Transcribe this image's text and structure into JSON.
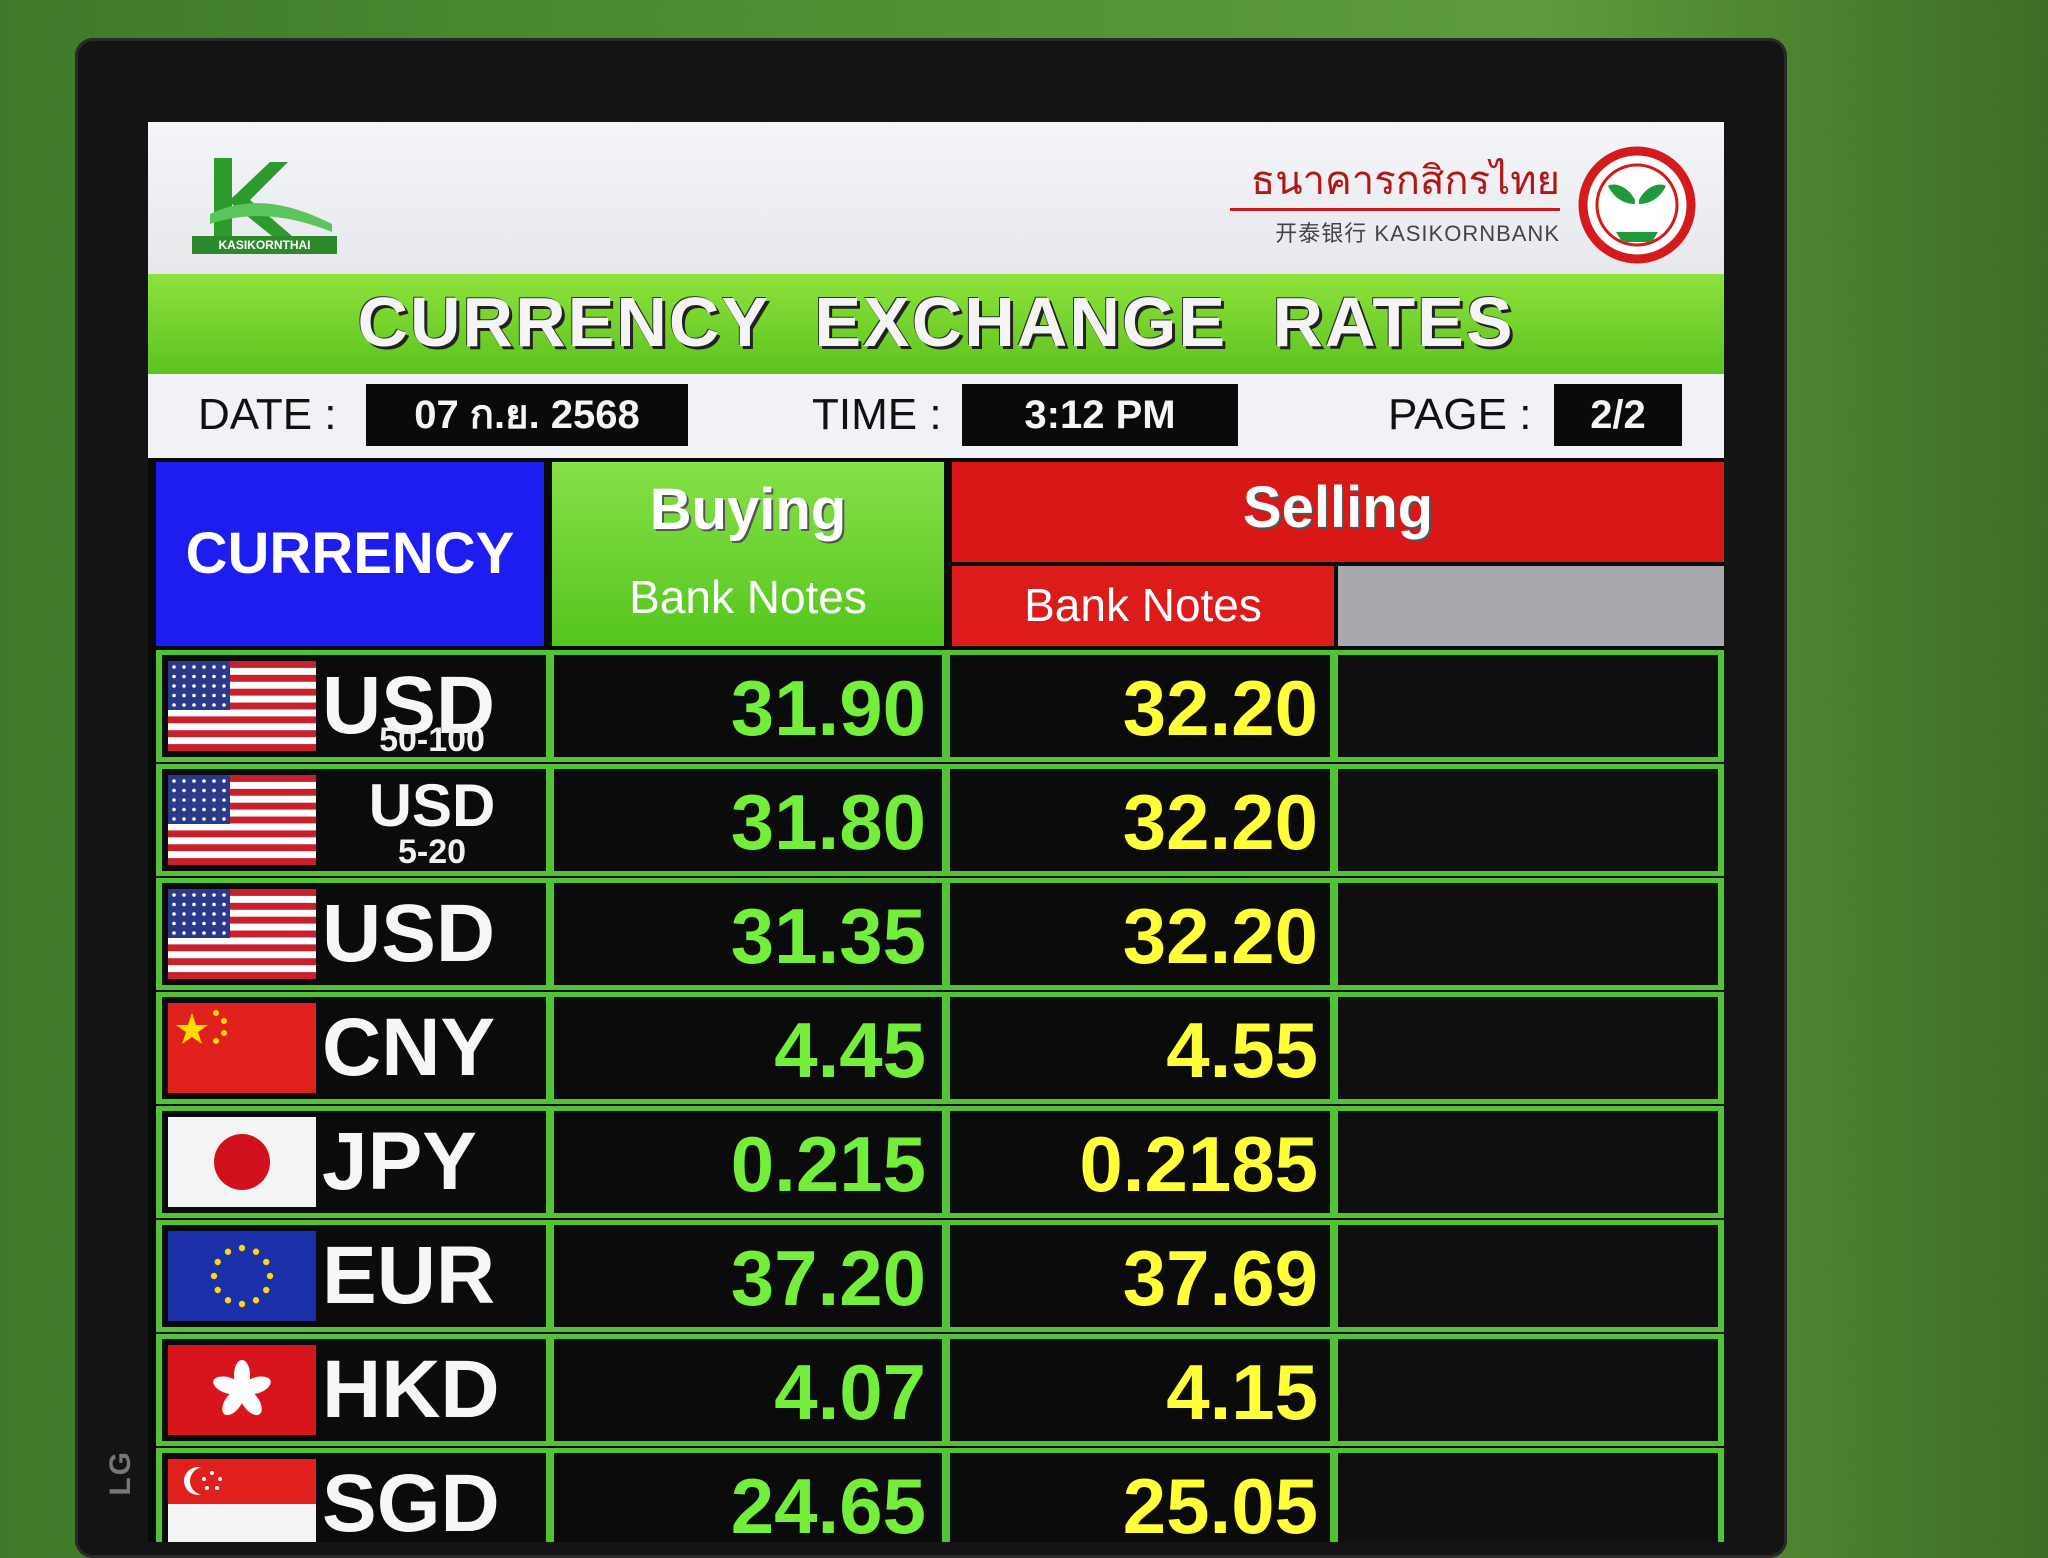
{
  "header": {
    "logo_text": "KASIKORNTHAI",
    "bank_name_thai": "ธนาคารกสิกรไทย",
    "bank_name_en": "开泰银行 KASIKORNBANK",
    "title": "CURRENCY EXCHANGE RATES"
  },
  "info": {
    "date_label": "DATE :",
    "date_value": "07 ก.ย. 2568",
    "time_label": "TIME :",
    "time_value": "3:12 PM",
    "page_label": "PAGE :",
    "page_value": "2/2"
  },
  "columns": {
    "currency": "CURRENCY",
    "buying": "Buying",
    "buying_sub": "Bank Notes",
    "selling": "Selling",
    "selling_sub": "Bank Notes"
  },
  "monitor_brand": "LG",
  "rates": [
    {
      "code": "USD",
      "denomination": "50-100",
      "flag": "us-flag",
      "buy": "31.90",
      "sell": "32.20"
    },
    {
      "code": "USD",
      "denomination": "5-20",
      "flag": "us-flag",
      "buy": "31.80",
      "sell": "32.20"
    },
    {
      "code": "USD",
      "denomination": "",
      "flag": "us-flag",
      "buy": "31.35",
      "sell": "32.20"
    },
    {
      "code": "CNY",
      "denomination": "",
      "flag": "china-flag",
      "buy": "4.45",
      "sell": "4.55"
    },
    {
      "code": "JPY",
      "denomination": "",
      "flag": "japan-flag",
      "buy": "0.215",
      "sell": "0.2185"
    },
    {
      "code": "EUR",
      "denomination": "",
      "flag": "eu-flag",
      "buy": "37.20",
      "sell": "37.69"
    },
    {
      "code": "HKD",
      "denomination": "",
      "flag": "hong-kong-flag",
      "buy": "4.07",
      "sell": "4.15"
    },
    {
      "code": "SGD",
      "denomination": "",
      "flag": "singapore-flag",
      "buy": "24.65",
      "sell": "25.05"
    }
  ]
}
